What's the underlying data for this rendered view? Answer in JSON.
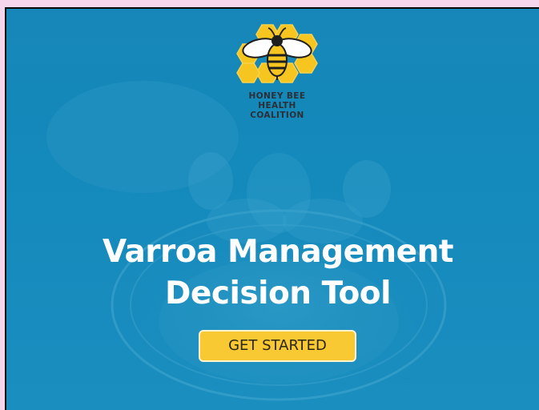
{
  "logo": {
    "icon": "bee-on-honeycomb-icon",
    "line1": "HONEY BEE",
    "line2": "HEALTH",
    "line3": "COALITION"
  },
  "hero": {
    "title_line1": "Varroa Management",
    "title_line2": "Decision Tool",
    "cta_label": "GET STARTED"
  },
  "colors": {
    "page_background": "#f6d6ec",
    "hero_background": "#1489bb",
    "button": "#f8c933",
    "logo_yellow": "#f7c51f"
  }
}
